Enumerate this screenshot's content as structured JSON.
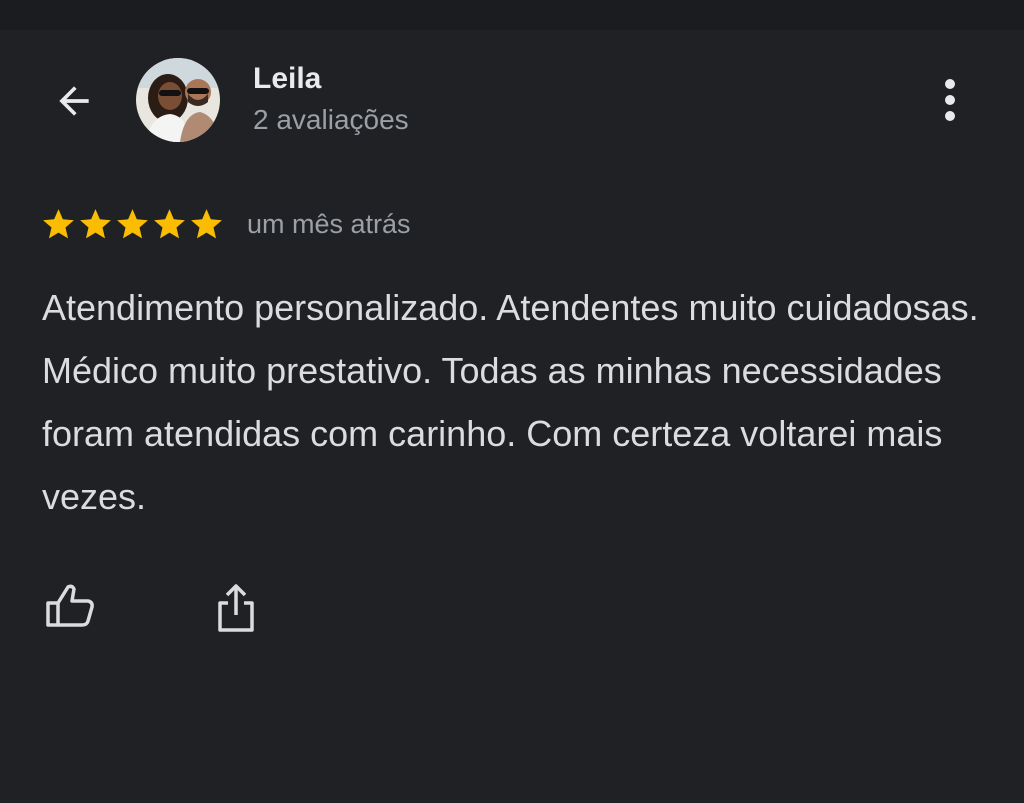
{
  "header": {
    "reviewer_name": "Leila",
    "review_count": "2 avaliações",
    "back_icon": "arrow-left-icon",
    "more_icon": "more-vertical-icon"
  },
  "review": {
    "rating": 5,
    "rating_max": 5,
    "time_ago": "um mês atrás",
    "text": "Atendimento personalizado. Atendentes muito cuidadosas. Médico muito prestativo. Todas as minhas necessidades foram atendidas com carinho. Com certeza voltarei mais vezes."
  },
  "actions": {
    "like_icon": "thumbs-up-icon",
    "share_icon": "share-icon"
  },
  "colors": {
    "background": "#202124",
    "star": "#fbbc04",
    "primary_text": "#e8eaed",
    "secondary_text": "#9aa0a6",
    "body_text": "#dadce0"
  }
}
